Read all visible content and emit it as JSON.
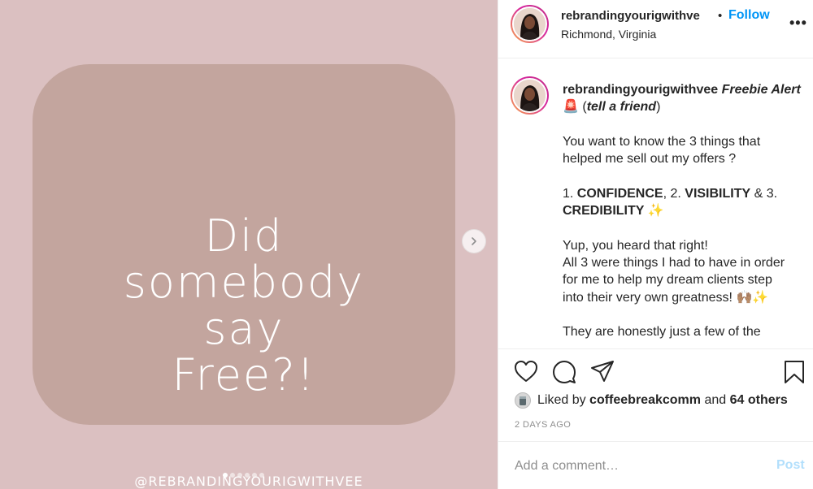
{
  "media": {
    "card_lines": [
      "Did",
      "somebody",
      "say",
      "Free?!"
    ],
    "watermark": "@REBRANDINGYOURIGWITHVEE",
    "carousel_dots": 6,
    "active_dot": 0
  },
  "header": {
    "username": "rebrandingyourigwithve",
    "separator": "•",
    "follow_label": "Follow",
    "location": "Richmond, Virginia",
    "more_label": "•••"
  },
  "caption": {
    "username": "rebrandingyourigwithvee",
    "title": "Freebie Alert",
    "siren": "🚨",
    "tell": "tell a friend",
    "line1": "You want to know the 3 things that",
    "line2": "helped me sell out my offers ?",
    "l3_a": "1. ",
    "l3_b": "CONFIDENCE",
    "l3_c": ", 2. ",
    "l3_d": "VISIBILITY",
    "l3_e": " & 3.",
    "l4_a": "CREDIBILITY",
    "l4_b": " ✨",
    "line5": "Yup, you heard that right!",
    "line6": "All 3 were things I had to have in order",
    "line7": "for me to help my dream clients step",
    "line8": "into their very own greatness! 🙌🏽✨",
    "line9": "They are honestly just a few of the"
  },
  "likes": {
    "prefix": "Liked by ",
    "user": "coffeebreakcomm",
    "middle": " and ",
    "others": "64 others"
  },
  "timestamp": "2 DAYS AGO",
  "comment": {
    "placeholder": "Add a comment…",
    "post_label": "Post"
  },
  "colors": {
    "media_bg": "#dbc0c1",
    "card_bg": "#c3a59e",
    "follow": "#0095f6",
    "post_disabled": "#b2dffc"
  }
}
